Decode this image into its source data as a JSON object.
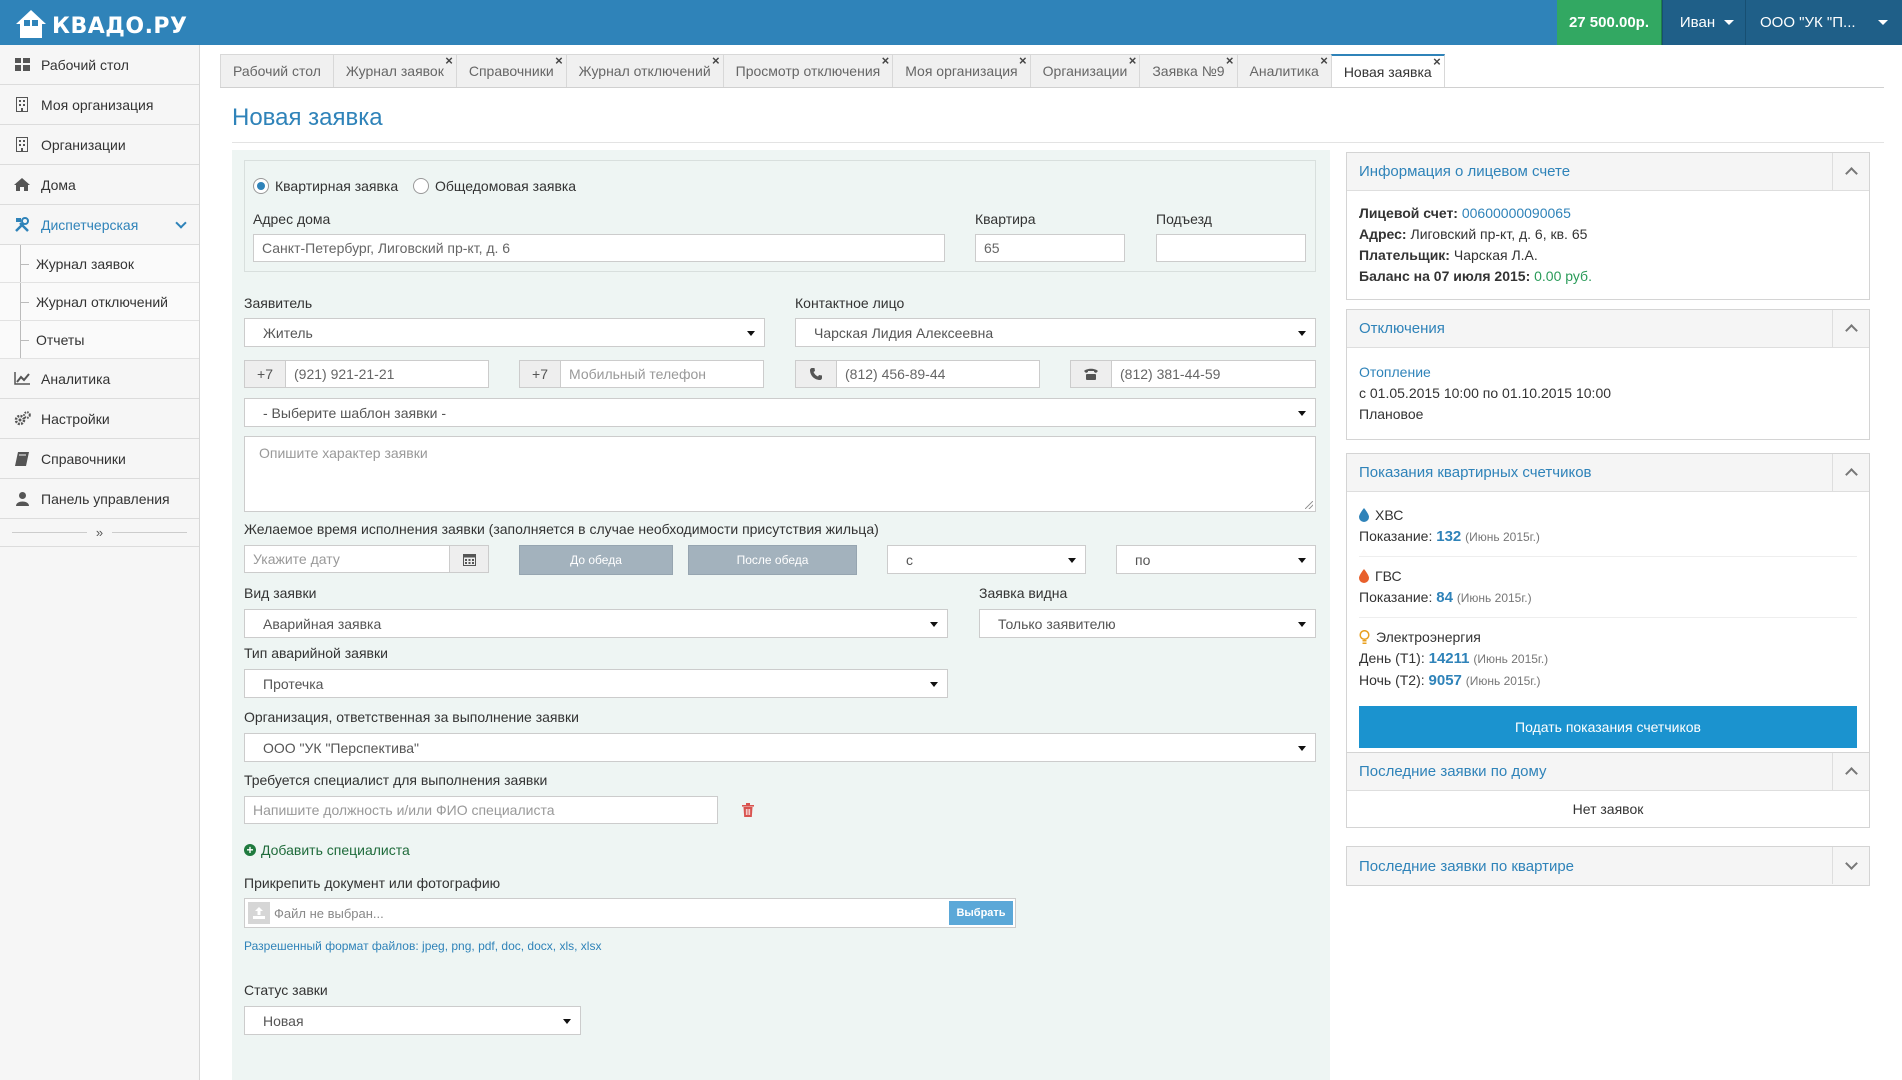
{
  "header": {
    "logo_text": "КВАДО.РУ",
    "balance": "27 500.00р.",
    "user": "Иван",
    "org": "ООО \"УК \"П..."
  },
  "sidebar": {
    "items": [
      {
        "label": "Рабочий стол",
        "icon": "dashboard-icon"
      },
      {
        "label": "Моя организация",
        "icon": "building-icon"
      },
      {
        "label": "Организации",
        "icon": "building-icon"
      },
      {
        "label": "Дома",
        "icon": "home-icon"
      },
      {
        "label": "Диспетчерская",
        "icon": "tools-icon"
      },
      {
        "label": "Аналитика",
        "icon": "chart-line-icon"
      },
      {
        "label": "Настройки",
        "icon": "gears-icon"
      },
      {
        "label": "Справочники",
        "icon": "book-icon"
      },
      {
        "label": "Панель управления",
        "icon": "user-icon"
      }
    ],
    "sub_items": [
      "Журнал заявок",
      "Журнал отключений",
      "Отчеты"
    ],
    "collapse_label": "»"
  },
  "tabs": [
    {
      "label": "Рабочий стол",
      "closable": false
    },
    {
      "label": "Журнал заявок",
      "closable": true
    },
    {
      "label": "Справочники",
      "closable": true
    },
    {
      "label": "Журнал отключений",
      "closable": true
    },
    {
      "label": "Просмотр отключения",
      "closable": true
    },
    {
      "label": "Моя организация",
      "closable": true
    },
    {
      "label": "Организации",
      "closable": true
    },
    {
      "label": "Заявка №9",
      "closable": true
    },
    {
      "label": "Аналитика",
      "closable": true
    },
    {
      "label": "Новая заявка",
      "closable": true
    }
  ],
  "tab_close": "×",
  "page": {
    "title": "Новая заявка"
  },
  "form": {
    "radio_apartment": "Квартирная заявка",
    "radio_building": "Общедомовая заявка",
    "address_label": "Адрес дома",
    "address_value": "Санкт-Петербург, Лиговский пр-кт, д. 6",
    "apt_label": "Квартира",
    "apt_value": "65",
    "entrance_label": "Подъезд",
    "entrance_value": "",
    "applicant_label": "Заявитель",
    "applicant_value": "Житель",
    "contact_label": "Контактное лицо",
    "contact_value": "Чарская Лидия Алексеевна",
    "phone_prefix": "+7",
    "phone1_value": "(921) 921-21-21",
    "phone2_placeholder": "Мобильный телефон",
    "phone3_value": "(812) 456-89-44",
    "phone4_value": "(812) 381-44-59",
    "template_value": "- Выберите шаблон заявки -",
    "description_placeholder": "Опишите характер заявки",
    "time_label": "Желаемое время исполнения заявки (заполняется в случае необходимости присутствия жильца)",
    "date_placeholder": "Укажите дату",
    "before_lunch": "До обеда",
    "after_lunch": "После обеда",
    "from_value": "с",
    "to_value": "по",
    "kind_label": "Вид заявки",
    "kind_value": "Аварийная заявка",
    "visible_label": "Заявка видна",
    "visible_value": "Только заявителю",
    "emergency_type_label": "Тип аварийной заявки",
    "emergency_type_value": "Протечка",
    "org_label": "Организация, ответственная за выполнение заявки",
    "org_value": "ООО \"УК \"Перспектива\"",
    "specialist_label": "Требуется специалист для выполнения заявки",
    "specialist_placeholder": "Напишите должность и/или ФИО специалиста",
    "add_specialist": "Добавить специалиста",
    "attach_label": "Прикрепить документ или фотографию",
    "file_placeholder": "Файл не выбран...",
    "file_button": "Выбрать",
    "file_formats": "Разрешенный формат файлов: jpeg, png, pdf, doc, docx, xls, xlsx",
    "status_label": "Статус завки",
    "status_value": "Новая"
  },
  "panels": {
    "account": {
      "title": "Информация о лицевом счете",
      "account_label": "Лицевой счет:",
      "account_value": "00600000090065",
      "address_label": "Адрес:",
      "address_value": "Лиговский пр-кт, д. 6, кв. 65",
      "payer_label": "Плательщик:",
      "payer_value": "Чарская Л.А.",
      "balance_label": "Баланс на 07 июля 2015:",
      "balance_value": "0.00 руб."
    },
    "outages": {
      "title": "Отключения",
      "name": "Отопление",
      "period": "с 01.05.2015 10:00 по 01.10.2015 10:00",
      "type": "Плановое"
    },
    "meters": {
      "title": "Показания квартирных счетчиков",
      "cold": {
        "name": "ХВС",
        "label": "Показание:",
        "value": "132",
        "period": "(Июнь 2015г.)"
      },
      "hot": {
        "name": "ГВС",
        "label": "Показание:",
        "value": "84",
        "period": "(Июнь 2015г.)"
      },
      "electric": {
        "name": "Электроэнергия",
        "day_label": "День (Т1):",
        "day_value": "14211",
        "day_period": "(Июнь 2015г.)",
        "night_label": "Ночь (Т2):",
        "night_value": "9057",
        "night_period": "(Июнь 2015г.)"
      },
      "button": "Подать показания счетчиков"
    },
    "house_requests": {
      "title": "Последние заявки по дому",
      "empty": "Нет заявок"
    },
    "apt_requests": {
      "title": "Последние заявки по квартире"
    }
  },
  "colors": {
    "brand": "#2f83b9",
    "balance_green": "#32a862",
    "action_blue": "#1b93cf"
  }
}
